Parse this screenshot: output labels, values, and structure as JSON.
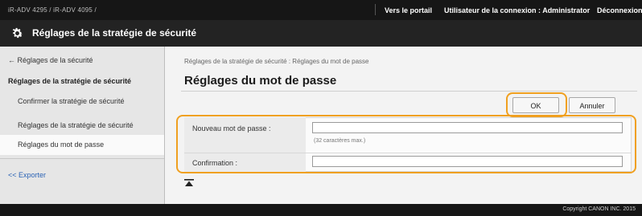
{
  "topbar": {
    "device": "iR-ADV 4295 / iR-ADV 4095 /",
    "portal": "Vers le portail",
    "user": "Utilisateur de la connexion : Administrator",
    "logout": "Déconnexion"
  },
  "titlebar": {
    "title": "Réglages de la stratégie de sécurité",
    "icon": "gear-icon"
  },
  "sidebar": {
    "back": "← Réglages de la sécurité",
    "heading": "Réglages de la stratégie de sécurité",
    "items": [
      {
        "label": "Confirmer la stratégie de sécurité"
      },
      {
        "label": "Réglages de la stratégie de sécurité"
      },
      {
        "label": "Réglages du mot de passe"
      }
    ],
    "export": "<< Exporter"
  },
  "main": {
    "breadcrumb": "Réglages de la stratégie de sécurité : Réglages du mot de passe",
    "heading": "Réglages du mot de passe",
    "ok_label": "OK",
    "cancel_label": "Annuler",
    "form": {
      "new_password_label": "Nouveau mot de passe :",
      "new_password_value": "",
      "new_password_hint": "(32 caractères max.)",
      "confirm_label": "Confirmation :",
      "confirm_value": ""
    }
  },
  "footer": {
    "copyright": "Copyright CANON INC. 2015"
  },
  "colors": {
    "highlight": "#f0a020",
    "link": "#2b63b5",
    "header_bg": "#161616"
  }
}
